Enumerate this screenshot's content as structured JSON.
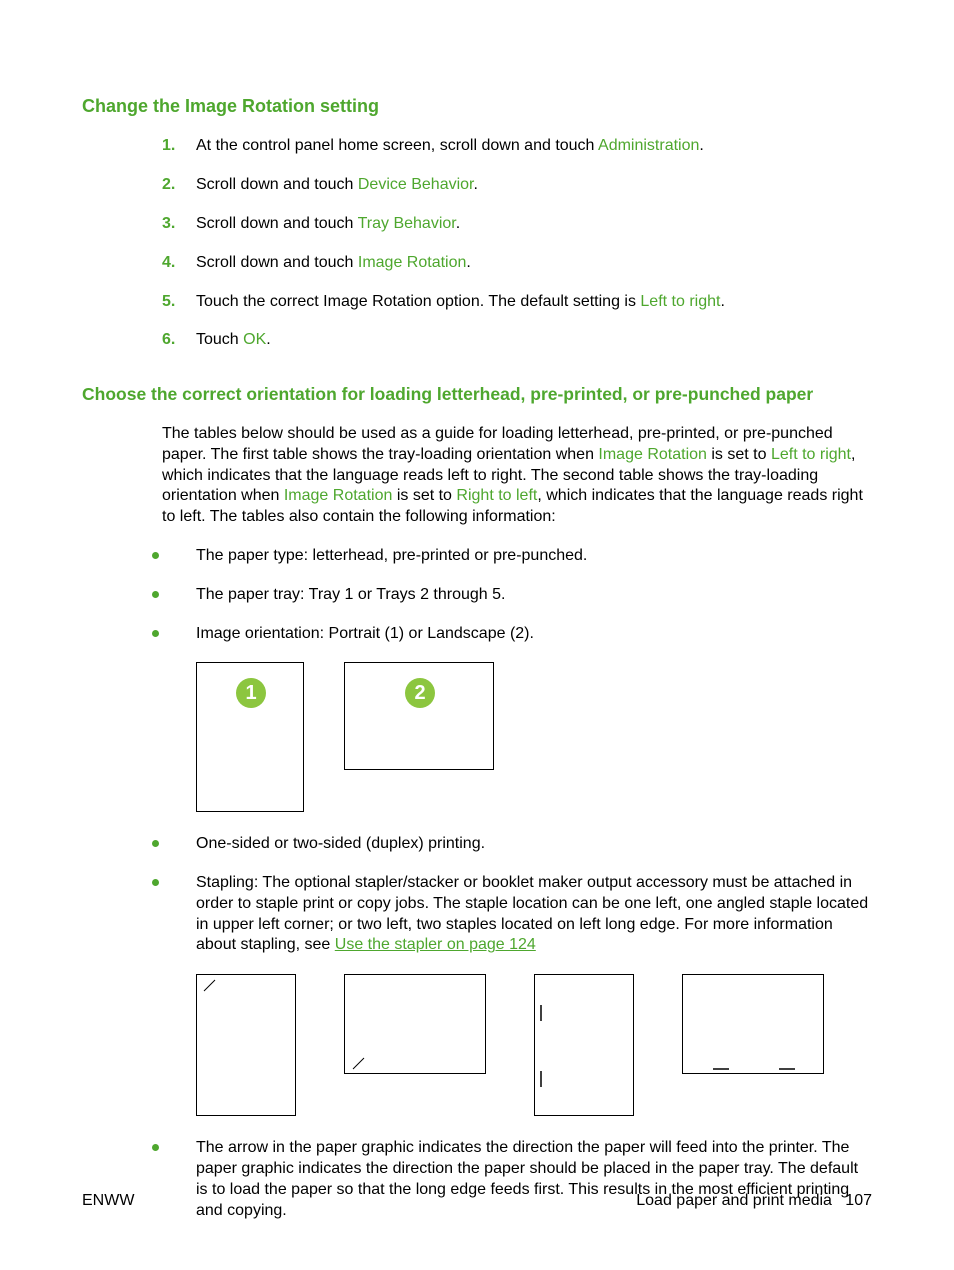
{
  "heading1": "Change the Image Rotation setting",
  "steps": [
    {
      "num": "1.",
      "pre": "At the control panel home screen, scroll down and touch ",
      "term": "Administration",
      "post": "."
    },
    {
      "num": "2.",
      "pre": "Scroll down and touch ",
      "term": "Device Behavior",
      "post": "."
    },
    {
      "num": "3.",
      "pre": "Scroll down and touch ",
      "term": "Tray Behavior",
      "post": "."
    },
    {
      "num": "4.",
      "pre": "Scroll down and touch ",
      "term": "Image Rotation",
      "post": "."
    },
    {
      "num": "5.",
      "pre": "Touch the correct Image Rotation option. The default setting is ",
      "term": "Left to right",
      "post": "."
    },
    {
      "num": "6.",
      "pre": "Touch ",
      "term": "OK",
      "post": "."
    }
  ],
  "heading2": "Choose the correct orientation for loading letterhead, pre-printed, or pre-punched paper",
  "para": {
    "p1": "The tables below should be used as a guide for loading letterhead, pre-printed, or pre-punched paper. The first table shows the tray-loading orientation when ",
    "t1": "Image Rotation",
    "p2": " is set to ",
    "t2": "Left to right",
    "p3": ", which indicates that the language reads left to right. The second table shows the tray-loading orientation when ",
    "t3": "Image Rotation",
    "p4": " is set to ",
    "t4": "Right to left",
    "p5": ", which indicates that the language reads right to left. The tables also contain the following information:"
  },
  "bullets1": [
    "The paper type: letterhead, pre-printed or pre-punched.",
    "The paper tray: Tray 1 or Trays 2 through 5.",
    "Image orientation: Portrait (1) or Landscape (2)."
  ],
  "badges": {
    "portrait": "1",
    "landscape": "2"
  },
  "bullets2": [
    "One-sided or two-sided (duplex) printing."
  ],
  "stapling": {
    "text": "Stapling: The optional stapler/stacker or booklet maker output accessory must be attached in order to staple print or copy jobs. The staple location can be one left, one angled staple located in upper left corner; or two left, two staples located on left long edge. For more information about stapling, see ",
    "link": "Use the stapler on page 124"
  },
  "bullets3": [
    "The arrow in the paper graphic indicates the direction the paper will feed into the printer. The paper graphic indicates the direction the paper should be placed in the paper tray. The default is to load the paper so that the long edge feeds first. This results in the most efficient printing and copying."
  ],
  "footer": {
    "left": "ENWW",
    "right_label": "Load paper and print media",
    "right_page": "107"
  }
}
